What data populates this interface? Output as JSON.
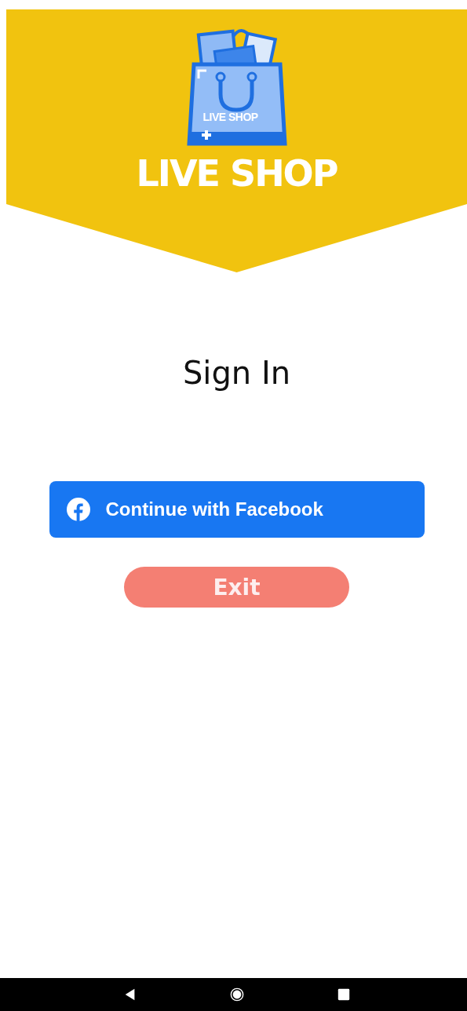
{
  "logo": {
    "bag_label": "LIVE SHOP",
    "title": "LIVE SHOP"
  },
  "heading": "Sign In",
  "buttons": [
    {
      "kind": "facebook",
      "label": "Continue with Facebook"
    },
    {
      "kind": "exit",
      "label": "Exit"
    }
  ]
}
